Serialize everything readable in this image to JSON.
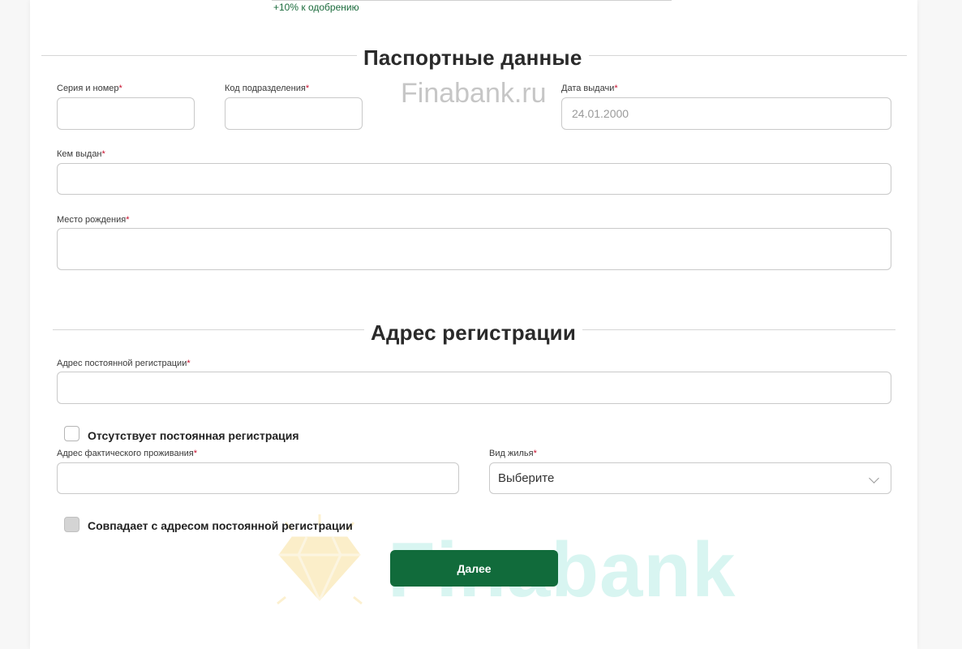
{
  "header": {
    "bonus_text": "+10% к одобрению"
  },
  "passport": {
    "title": "Паспортные данные",
    "series_label": "Серия и номер",
    "code_label": "Код подразделения",
    "date_label": "Дата выдачи",
    "date_placeholder": "24.01.2000",
    "issued_by_label": "Кем выдан",
    "birthplace_label": "Место рождения"
  },
  "registration": {
    "title": "Адрес регистрации",
    "permanent_label": "Адрес постоянной регистрации",
    "no_permanent_checkbox": "Отсутствует постоянная регистрация",
    "actual_label": "Адрес фактического проживания",
    "housing_label": "Вид жилья",
    "housing_selected": "Выберите",
    "same_address_checkbox": "Совпадает с адресом постоянной регистрации"
  },
  "required_mark": "*",
  "actions": {
    "next_label": "Далее"
  },
  "watermarks": {
    "site_text": "Finabank.ru",
    "logo_text": "Finabank"
  },
  "colors": {
    "accent": "#116b3b",
    "required": "#c8102e",
    "bonus": "#1b6b3c"
  }
}
